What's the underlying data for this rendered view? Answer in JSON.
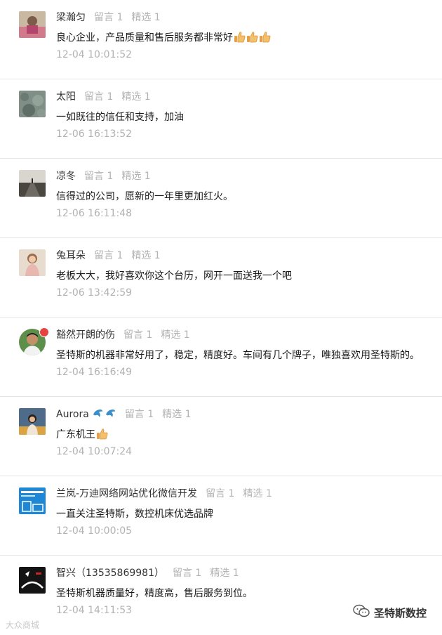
{
  "labels": {
    "replies": "留言 1",
    "featured": "精选 1"
  },
  "comments": [
    {
      "nickname": "梁瀚匀",
      "text": "良心企业，产品质量和售后服务都非常好",
      "time": "12-04 10:01:52",
      "emoji": "thumbs-up-icon"
    },
    {
      "nickname": "太阳",
      "text": "一如既往的信任和支持，加油",
      "time": "12-06 16:13:52"
    },
    {
      "nickname": "凉冬",
      "text": "信得过的公司，愿新的一年里更加红火。",
      "time": "12-06 16:11:48"
    },
    {
      "nickname": "兔耳朵",
      "text": "老板大大，我好喜欢你这个台历，网开一面送我一个吧",
      "time": "12-06 13:42:59"
    },
    {
      "nickname": "豁然开朗的伤",
      "text": "圣特斯的机器非常好用了，稳定，精度好。车间有几个牌子，唯独喜欢用圣特斯的。",
      "time": "12-04 16:16:49"
    },
    {
      "nickname": "Aurora",
      "text": "广东机王",
      "time": "12-04 10:07:24",
      "emoji": "thumbs-up-icon"
    },
    {
      "nickname": "兰岚-万迪网络网站优化微信开发",
      "text": "一直关注圣特斯，数控机床优选品牌",
      "time": "12-04 10:00:05"
    },
    {
      "nickname": "智兴（13535869981）",
      "text": "圣特斯机器质量好，精度高，售后服务到位。",
      "time": "12-04 14:11:53"
    }
  ],
  "watermark": "大众商城",
  "brand": {
    "name": "圣特斯数控",
    "icon": "wechat-icon"
  },
  "colors": {
    "meta_gray": "#b2b2b2",
    "text": "#1a1a1a",
    "divider": "#e6e6e6",
    "badge_red": "#e64340"
  }
}
